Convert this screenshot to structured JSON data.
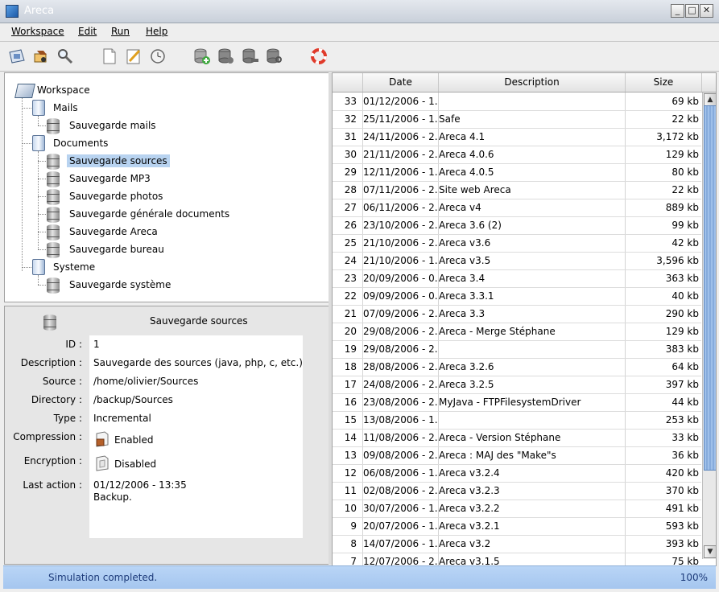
{
  "window": {
    "title": "Areca",
    "controls": [
      "_",
      "□",
      "✕"
    ]
  },
  "menu": [
    {
      "label": "Workspace"
    },
    {
      "label": "Edit"
    },
    {
      "label": "Run"
    },
    {
      "label": "Help"
    }
  ],
  "toolbar_icons": [
    "open-workspace-icon",
    "backup-icon",
    "search-icon",
    "new-icon",
    "edit-icon",
    "clock-icon",
    "db-add-icon",
    "db-icon",
    "db-remove-icon",
    "db-search-icon",
    "help-lifebuoy-icon"
  ],
  "tree": {
    "root": "Workspace",
    "groups": [
      {
        "label": "Mails",
        "targets": [
          "Sauvegarde mails"
        ]
      },
      {
        "label": "Documents",
        "targets": [
          "Sauvegarde sources",
          "Sauvegarde MP3",
          "Sauvegarde photos",
          "Sauvegarde générale documents",
          "Sauvegarde Areca",
          "Sauvegarde bureau"
        ]
      },
      {
        "label": "Systeme",
        "targets": [
          "Sauvegarde système"
        ]
      }
    ],
    "selected": "Sauvegarde sources"
  },
  "details": {
    "title": "Sauvegarde sources",
    "labels": {
      "id": "ID :",
      "description": "Description :",
      "source": "Source :",
      "directory": "Directory :",
      "type": "Type :",
      "compression": "Compression :",
      "encryption": "Encryption :",
      "last_action": "Last action :"
    },
    "values": {
      "id": "1",
      "description": "Sauvegarde des sources (java, php, c, etc.)",
      "source": "/home/olivier/Sources",
      "directory": "/backup/Sources",
      "type": "Incremental",
      "compression": "Enabled",
      "encryption": "Disabled",
      "last_action_date": "01/12/2006 - 13:35",
      "last_action_kind": "Backup."
    }
  },
  "table": {
    "columns": [
      "",
      "Date",
      "Description",
      "Size"
    ],
    "rows": [
      {
        "id": "33",
        "date": "01/12/2006 - 1...",
        "desc": "",
        "size": "69 kb"
      },
      {
        "id": "32",
        "date": "25/11/2006 - 1...",
        "desc": "Safe",
        "size": "22 kb"
      },
      {
        "id": "31",
        "date": "24/11/2006 - 2...",
        "desc": "Areca 4.1",
        "size": "3,172 kb"
      },
      {
        "id": "30",
        "date": "21/11/2006 - 2...",
        "desc": "Areca 4.0.6",
        "size": "129 kb"
      },
      {
        "id": "29",
        "date": "12/11/2006 - 1...",
        "desc": "Areca 4.0.5",
        "size": "80 kb"
      },
      {
        "id": "28",
        "date": "07/11/2006 - 2...",
        "desc": "Site web Areca",
        "size": "22 kb"
      },
      {
        "id": "27",
        "date": "06/11/2006 - 2...",
        "desc": "Areca v4",
        "size": "889 kb"
      },
      {
        "id": "26",
        "date": "23/10/2006 - 2...",
        "desc": "Areca 3.6 (2)",
        "size": "99 kb"
      },
      {
        "id": "25",
        "date": "21/10/2006 - 2...",
        "desc": "Areca v3.6",
        "size": "42 kb"
      },
      {
        "id": "24",
        "date": "21/10/2006 - 1...",
        "desc": "Areca v3.5",
        "size": "3,596 kb"
      },
      {
        "id": "23",
        "date": "20/09/2006 - 0...",
        "desc": "Areca 3.4",
        "size": "363 kb"
      },
      {
        "id": "22",
        "date": "09/09/2006 - 0...",
        "desc": "Areca 3.3.1",
        "size": "40 kb"
      },
      {
        "id": "21",
        "date": "07/09/2006 - 2...",
        "desc": "Areca 3.3",
        "size": "290 kb"
      },
      {
        "id": "20",
        "date": "29/08/2006 - 2...",
        "desc": "Areca - Merge Stéphane",
        "size": "129 kb"
      },
      {
        "id": "19",
        "date": "29/08/2006 - 2...",
        "desc": "",
        "size": "383 kb"
      },
      {
        "id": "18",
        "date": "28/08/2006 - 2...",
        "desc": "Areca 3.2.6",
        "size": "64 kb"
      },
      {
        "id": "17",
        "date": "24/08/2006 - 2...",
        "desc": "Areca 3.2.5",
        "size": "397 kb"
      },
      {
        "id": "16",
        "date": "23/08/2006 - 2...",
        "desc": "MyJava - FTPFilesystemDriver",
        "size": "44 kb"
      },
      {
        "id": "15",
        "date": "13/08/2006 - 1...",
        "desc": "",
        "size": "253 kb"
      },
      {
        "id": "14",
        "date": "11/08/2006 - 2...",
        "desc": "Areca - Version Stéphane",
        "size": "33 kb"
      },
      {
        "id": "13",
        "date": "09/08/2006 - 2...",
        "desc": "Areca : MAJ des \"Make\"s",
        "size": "36 kb"
      },
      {
        "id": "12",
        "date": "06/08/2006 - 1...",
        "desc": "Areca v3.2.4",
        "size": "420 kb"
      },
      {
        "id": "11",
        "date": "02/08/2006 - 2...",
        "desc": "Areca v3.2.3",
        "size": "370 kb"
      },
      {
        "id": "10",
        "date": "30/07/2006 - 1...",
        "desc": "Areca v3.2.2",
        "size": "491 kb"
      },
      {
        "id": "9",
        "date": "20/07/2006 - 1...",
        "desc": "Areca v3.2.1",
        "size": "593 kb"
      },
      {
        "id": "8",
        "date": "14/07/2006 - 1...",
        "desc": "Areca v3.2",
        "size": "393 kb"
      },
      {
        "id": "7",
        "date": "12/07/2006 - 2...",
        "desc": "Areca v3.1.5",
        "size": "75 kb"
      }
    ]
  },
  "status": {
    "message": "Simulation completed.",
    "progress": "100%"
  },
  "colors": {
    "status_bar": "#a5c6ef",
    "selection": "#b8d3f0",
    "scroll_thumb": "#9fc0ea"
  }
}
